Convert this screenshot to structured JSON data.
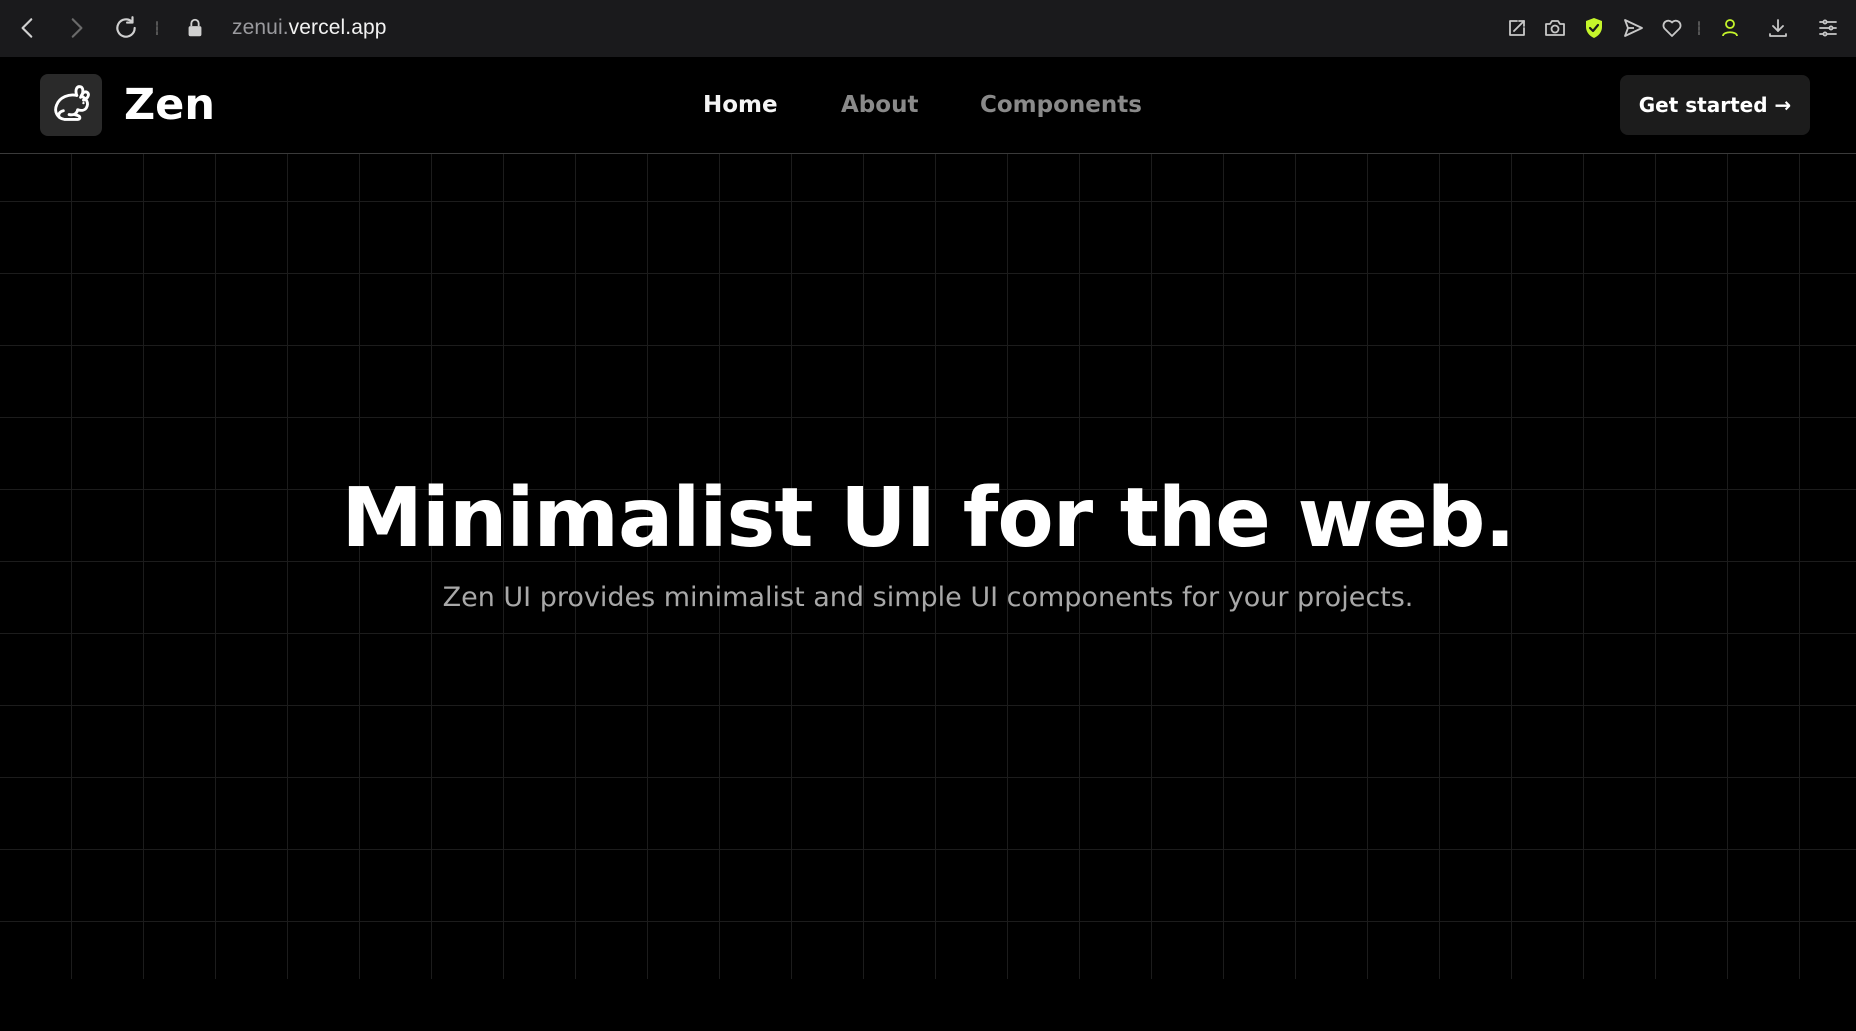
{
  "browser": {
    "url_prefix": "zenui.",
    "url_domain": "vercel.app",
    "icons": {
      "back": "chevron-left-icon",
      "forward": "chevron-right-icon",
      "reload": "reload-icon",
      "lock": "lock-icon",
      "share": "share-icon",
      "screenshot": "camera-icon",
      "shield": "shield-check-icon",
      "send": "send-icon",
      "bookmark": "heart-icon",
      "profile": "user-icon",
      "download": "download-icon",
      "menu": "menu-icon"
    },
    "colors": {
      "bar": "#1a1a1c",
      "shield": "#c5f52b",
      "profile": "#c5f52b"
    }
  },
  "header": {
    "brand": "Zen",
    "logo_icon": "rabbit-icon",
    "nav": [
      {
        "label": "Home",
        "active": true
      },
      {
        "label": "About",
        "active": false
      },
      {
        "label": "Components",
        "active": false
      }
    ],
    "cta_label": "Get started →"
  },
  "hero": {
    "title": "Minimalist UI for the web.",
    "subtitle": "Zen UI provides minimalist and simple UI components for your projects."
  }
}
